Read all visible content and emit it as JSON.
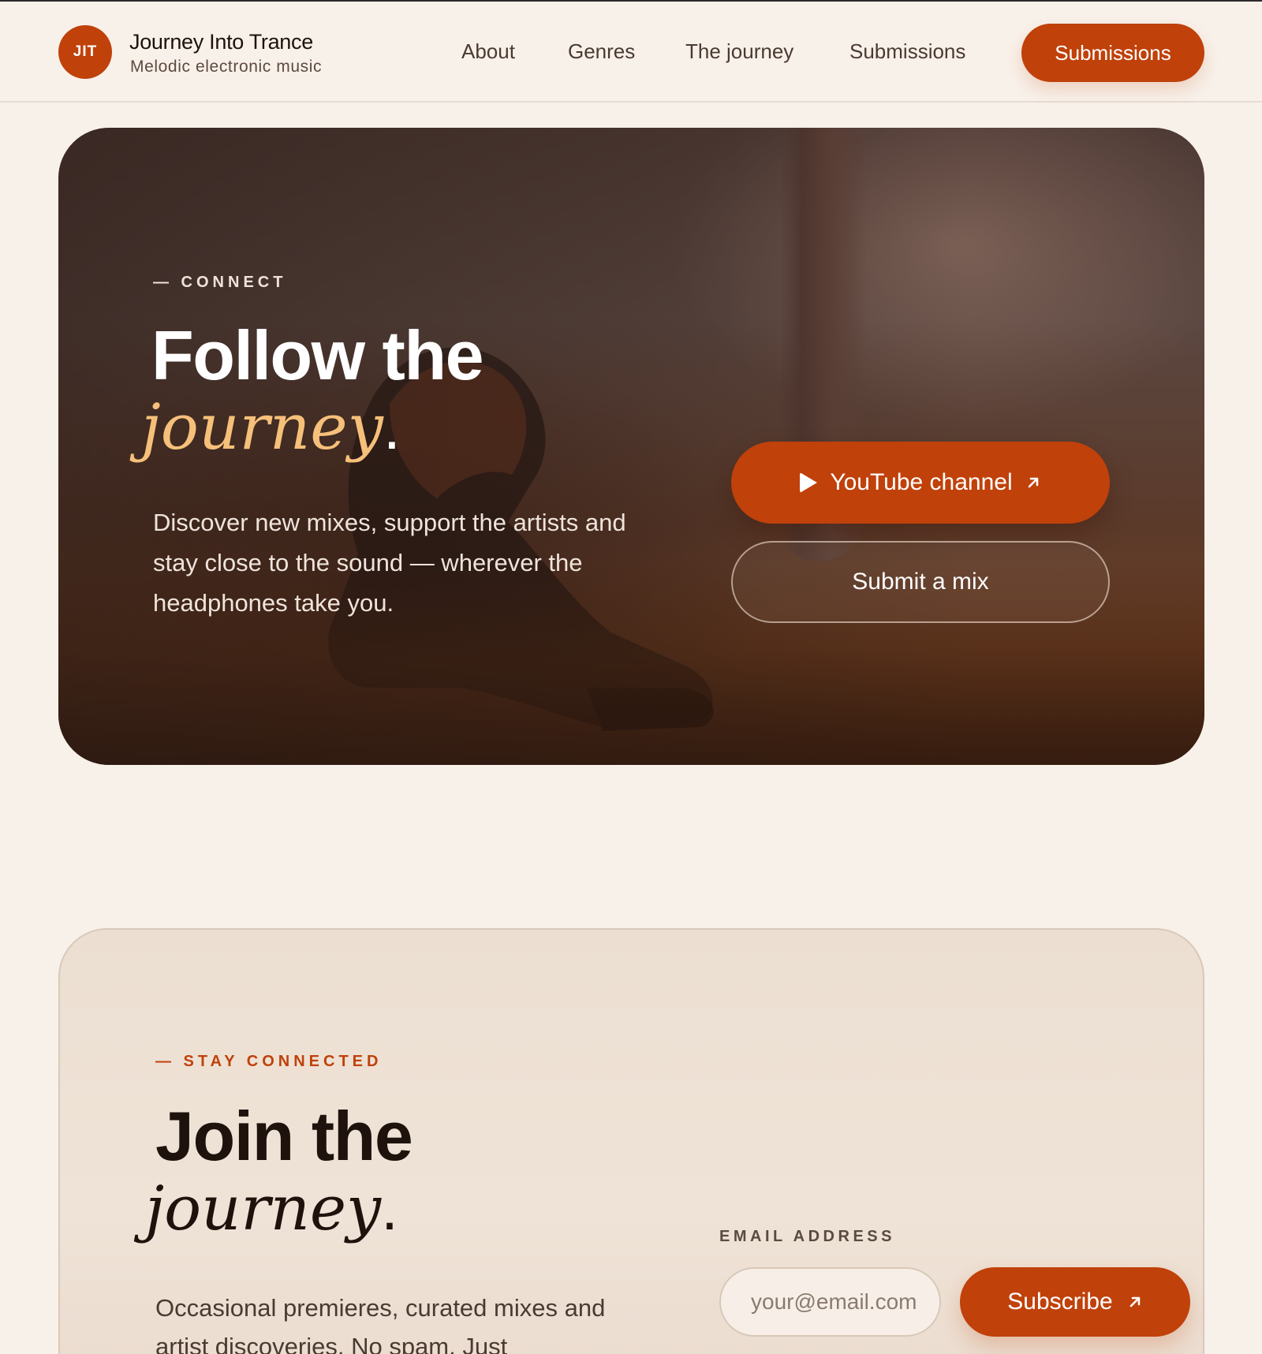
{
  "header": {
    "logo_text": "JIT",
    "brand_title": "Journey Into Trance",
    "brand_subtitle": "Melodic electronic music",
    "nav": {
      "about": "About",
      "genres": "Genres",
      "journey": "The journey",
      "submissions": "Submissions"
    },
    "cta_label": "Submissions"
  },
  "hero": {
    "eyebrow": "— CONNECT",
    "title_line1": "Follow the",
    "title_line2": "journey",
    "title_period": ".",
    "description": "Discover new mixes, support the artists and stay close to the sound — wherever the headphones take you.",
    "youtube_label": "YouTube channel",
    "youtube_icon": "play-icon",
    "external_icon": "arrow-up-right-icon",
    "submit_label": "Submit a mix"
  },
  "subscribe": {
    "eyebrow": "— STAY CONNECTED",
    "title_line1": "Join the",
    "title_line2": "journey",
    "title_period": ".",
    "description": "Occasional premieres, curated mixes and artist discoveries. No spam. Just",
    "email_label": "EMAIL ADDRESS",
    "email_placeholder": "your@email.com",
    "email_value": "",
    "button_label": "Subscribe"
  },
  "colors": {
    "accent": "#c0410a",
    "background": "#f8f1ea",
    "hero_highlight": "#f6c07a",
    "card_background": "#ecdfd2"
  }
}
